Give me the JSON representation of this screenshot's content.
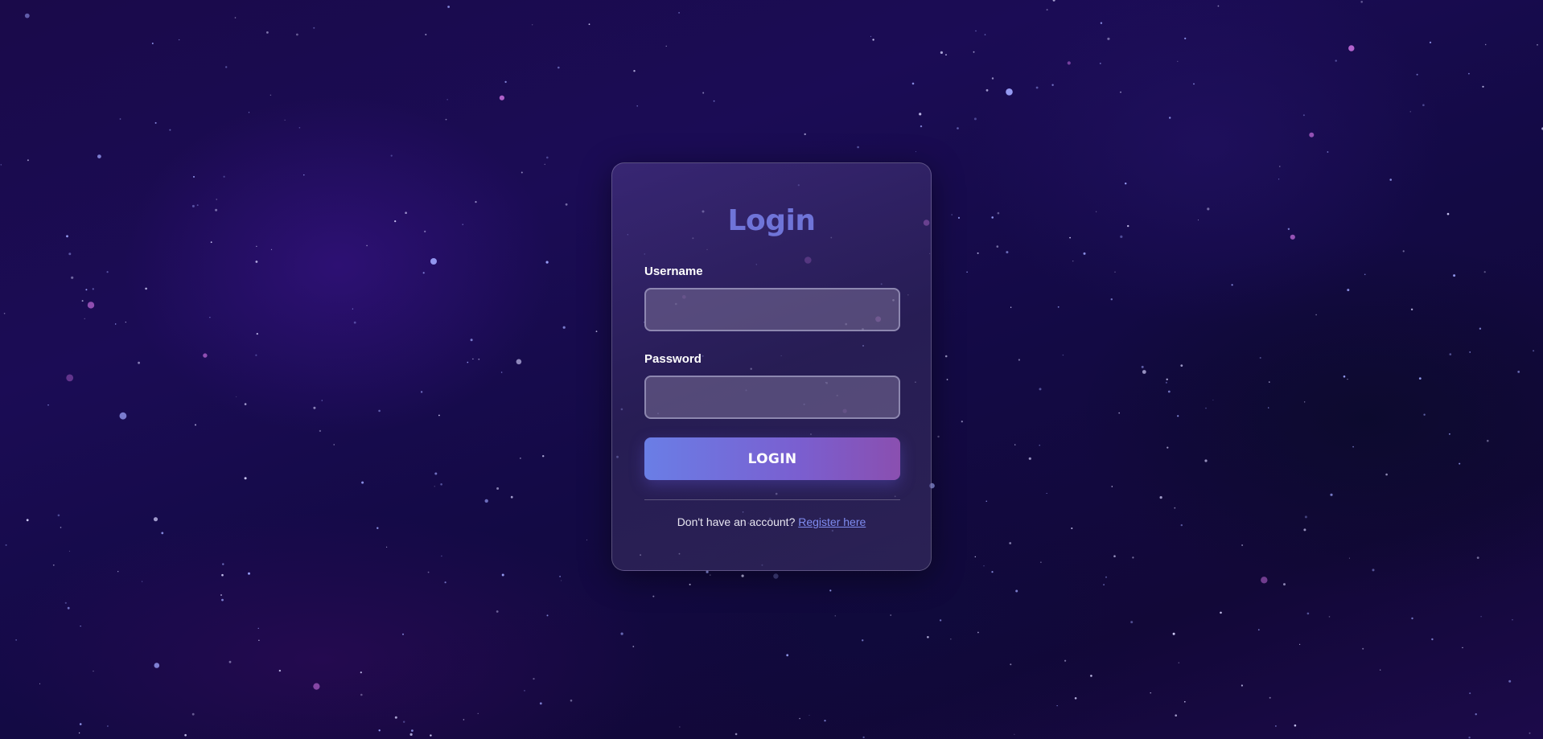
{
  "colors": {
    "background": "#170a48",
    "title": "#6f74d8",
    "button_start": "#6a7ee6",
    "button_end": "#8a4fb0",
    "link": "#7f8cf0"
  },
  "login_form": {
    "title": "Login",
    "username_label": "Username",
    "username_value": "",
    "password_label": "Password",
    "password_value": "",
    "submit_label": "LOGIN",
    "register_prompt": "Don't have an account?",
    "register_link": "Register here"
  }
}
